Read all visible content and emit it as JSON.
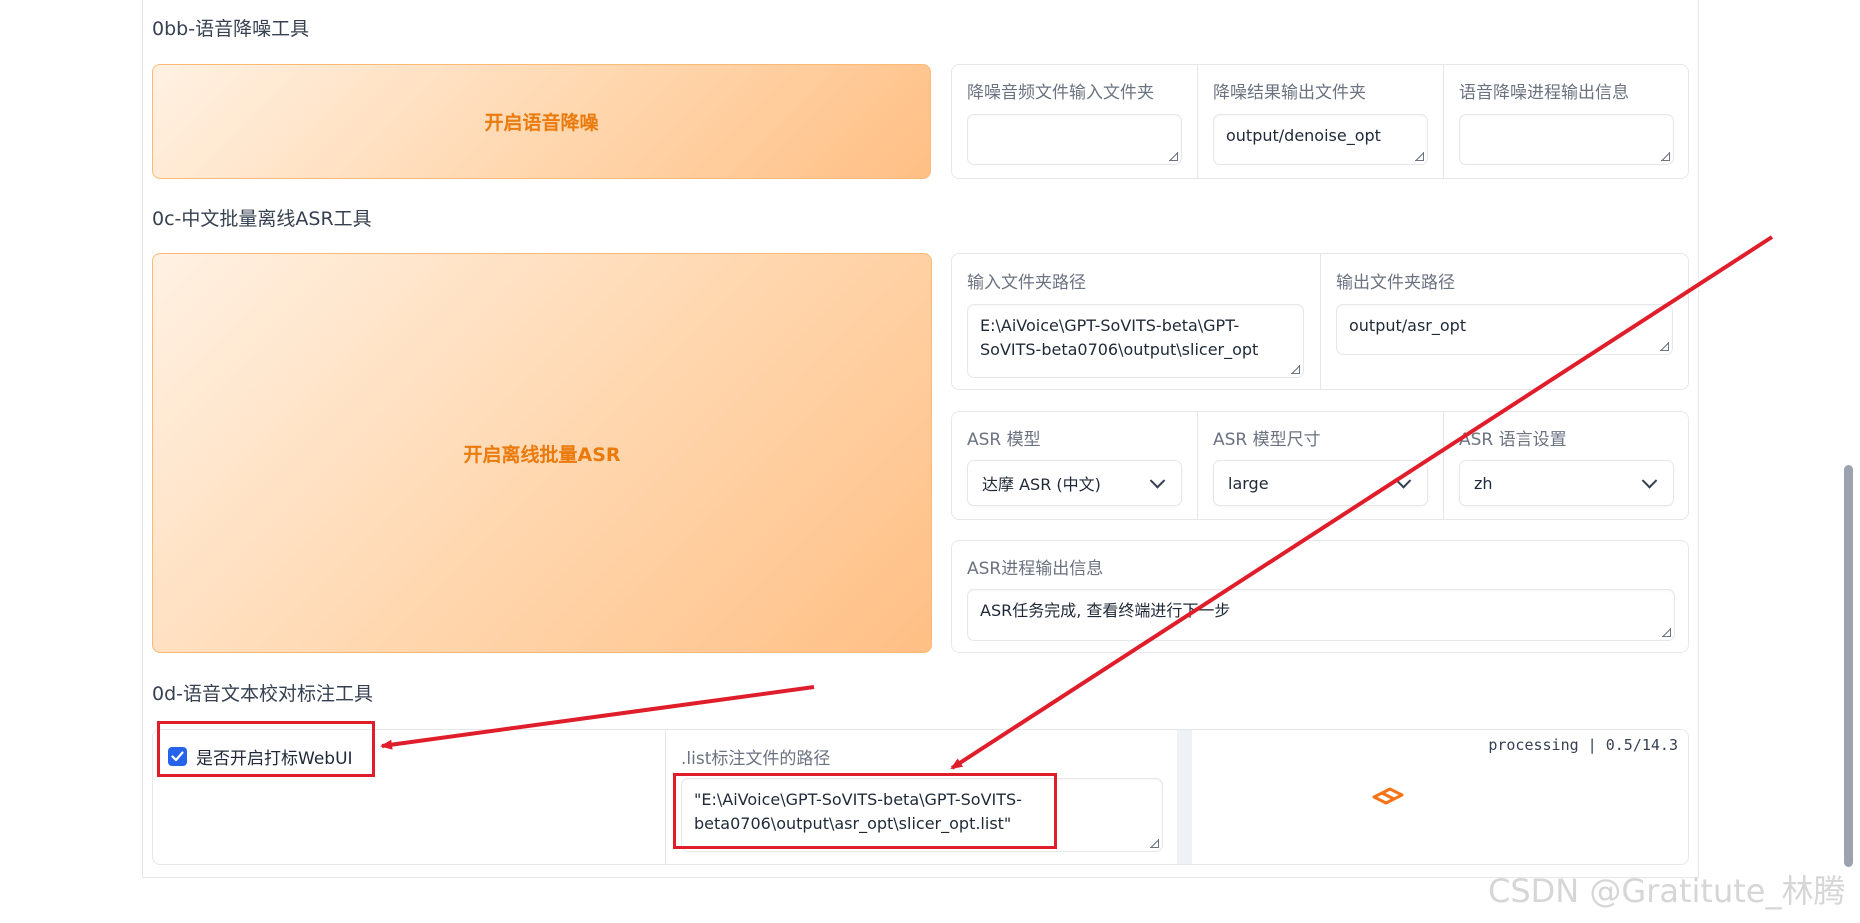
{
  "sections": {
    "denoise": {
      "title": "0bb-语音降噪工具",
      "button_label": "开启语音降噪",
      "input_dir_label": "降噪音频文件输入文件夹",
      "input_dir_value": "",
      "output_dir_label": "降噪结果输出文件夹",
      "output_dir_value": "output/denoise_opt",
      "progress_label": "语音降噪进程输出信息",
      "progress_value": ""
    },
    "asr": {
      "title": "0c-中文批量离线ASR工具",
      "button_label": "开启离线批量ASR",
      "input_dir_label": "输入文件夹路径",
      "input_dir_value": "E:\\AiVoice\\GPT-SoVITS-beta\\GPT-SoVITS-beta0706\\output\\slicer_opt",
      "output_dir_label": "输出文件夹路径",
      "output_dir_value": "output/asr_opt",
      "model_label": "ASR 模型",
      "model_value": "达摩 ASR (中文)",
      "model_size_label": "ASR 模型尺寸",
      "model_size_value": "large",
      "language_label": "ASR 语言设置",
      "language_value": "zh",
      "progress_label": "ASR进程输出信息",
      "progress_value": "ASR任务完成, 查看终端进行下一步"
    },
    "labeling": {
      "title": "0d-语音文本校对标注工具",
      "checkbox_label": "是否开启打标WebUI",
      "checkbox_checked": true,
      "list_path_label": ".list标注文件的路径",
      "list_path_value": "\"E:\\AiVoice\\GPT-SoVITS-beta\\GPT-SoVITS-beta0706\\output\\asr_opt\\slicer_opt.list\"",
      "status_text": "processing | 0.5/14.3"
    }
  },
  "watermark": "CSDN @Gratitute_林腾",
  "colors": {
    "accent_orange": "#ea7a0b",
    "button_gradient_start": "#fff1e3",
    "button_gradient_end": "#ffbf85",
    "checkbox_blue": "#2563eb",
    "annotation_red": "#e01e2b"
  }
}
